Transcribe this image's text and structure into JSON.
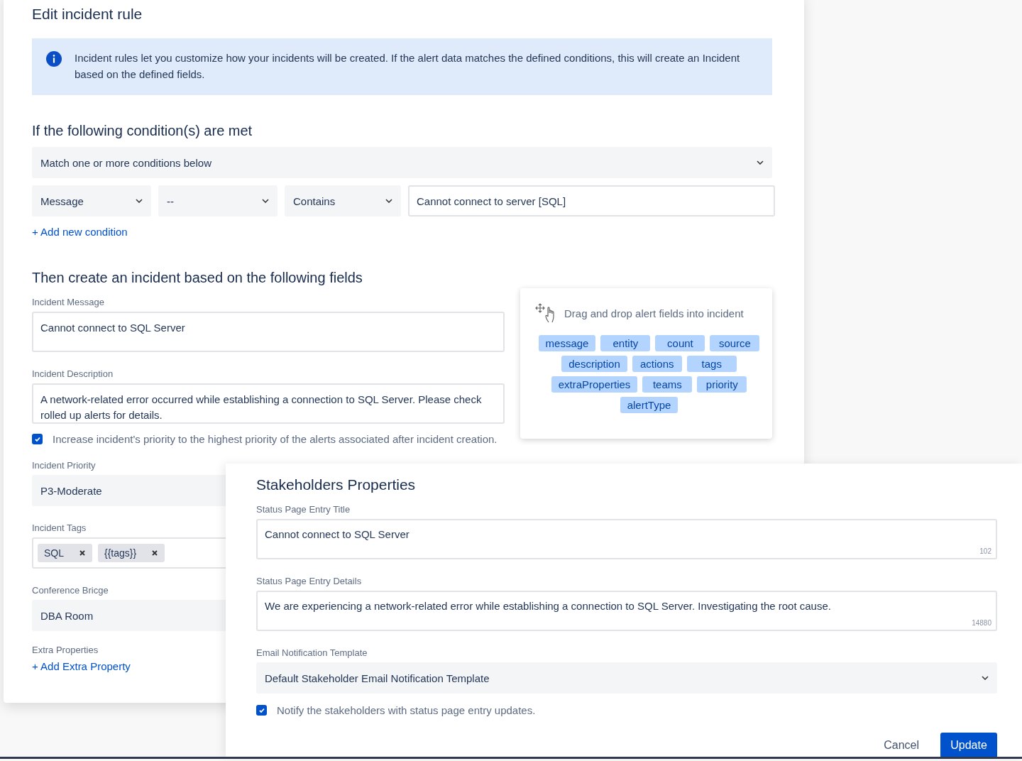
{
  "page_title": "Edit incident rule",
  "info_banner": {
    "text": "Incident rules let you customize how your incidents will be created. If the alert data matches the defined conditions, this will create an Incident based on the defined fields."
  },
  "conditions_section": {
    "heading": "If the following condition(s) are met",
    "match_select": {
      "value": "Match one or more conditions below"
    },
    "conditions": [
      {
        "field": "Message",
        "operator": "--",
        "comparison": "Contains",
        "value": "Cannot connect to server [SQL]"
      }
    ],
    "add_link": "+ Add new condition"
  },
  "fields_section": {
    "heading": "Then create an incident based on the following fields",
    "incident_message": {
      "label": "Incident Message",
      "value": "Cannot connect to SQL Server"
    },
    "incident_description": {
      "label": "Incident Description",
      "value": "A network-related error occurred while establishing a connection to SQL Server. Please check rolled up alerts for details."
    },
    "raise_priority": {
      "checked": true,
      "label": "Increase incident's priority to the highest priority of the alerts associated after incident creation."
    },
    "incident_priority": {
      "label": "Incident Priority",
      "value": "P3-Moderate"
    },
    "incident_tags": {
      "label": "Incident Tags",
      "tags": [
        "SQL",
        "{{tags}}"
      ]
    },
    "conference_bridge": {
      "label": "Conference Bricge",
      "value": "DBA Room"
    },
    "extra_properties": {
      "label": "Extra Properties",
      "add_link": "+ Add Extra Property"
    }
  },
  "drag_panel": {
    "hint": "Drag and drop alert fields into incident",
    "fields": [
      "message",
      "entity",
      "count",
      "source",
      "description",
      "actions",
      "tags",
      "extraProperties",
      "teams",
      "priority",
      "alertType"
    ]
  },
  "stakeholders": {
    "title": "Stakeholders Properties",
    "entry_title": {
      "label": "Status Page Entry Title",
      "value": "Cannot connect to SQL Server",
      "counter": "102"
    },
    "entry_details": {
      "label": "Status Page Entry Details",
      "value": "We are experiencing a network-related error while establishing a connection to SQL Server. Investigating the root cause.",
      "counter": "14880"
    },
    "email_template": {
      "label": "Email Notification Template",
      "value": "Default Stakeholder Email Notification Template"
    },
    "notify": {
      "checked": true,
      "label": "Notify the stakeholders with status page entry updates."
    },
    "buttons": {
      "cancel": "Cancel",
      "update": "Update"
    }
  }
}
